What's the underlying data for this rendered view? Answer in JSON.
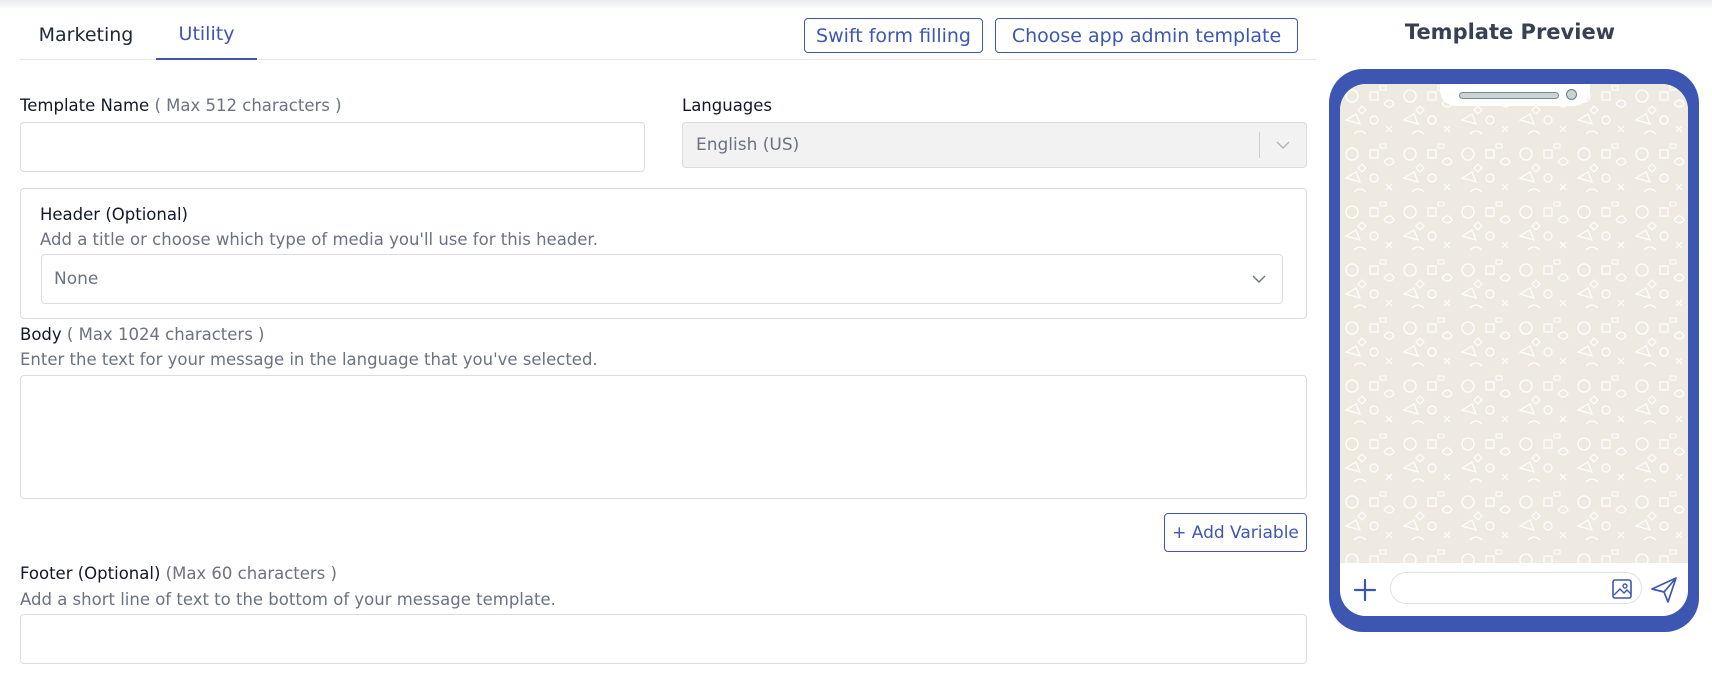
{
  "tabs": [
    {
      "label": "Marketing",
      "active": false
    },
    {
      "label": "Utility",
      "active": true
    }
  ],
  "actions": {
    "swift_label": "Swift form filling",
    "choose_label": "Choose app admin template"
  },
  "template_name": {
    "label": "Template Name",
    "hint": "( Max 512 characters )",
    "value": ""
  },
  "languages": {
    "label": "Languages",
    "value": "English (US)"
  },
  "header": {
    "label": "Header (Optional)",
    "description": "Add a title or choose which type of media you'll use for this header.",
    "value": "None"
  },
  "body": {
    "label": "Body",
    "hint": "( Max 1024 characters )",
    "description": "Enter the text for your message in the language that you've selected.",
    "value": ""
  },
  "add_variable_label": "+ Add Variable",
  "footer": {
    "label": "Footer (Optional)",
    "hint": "(Max 60 characters )",
    "description": "Add a short line of text to the bottom of your message template.",
    "value": ""
  },
  "preview": {
    "title": "Template Preview",
    "icons": [
      "plus-icon",
      "gallery-icon",
      "send-icon"
    ]
  },
  "colors": {
    "accent": "#3d56b2",
    "wallpaper": "#efeae1"
  }
}
